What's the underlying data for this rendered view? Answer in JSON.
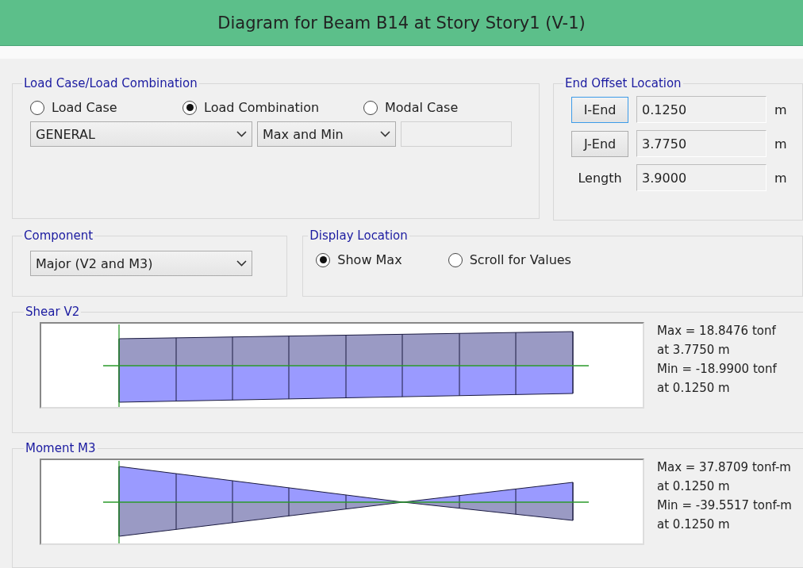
{
  "window": {
    "title": "Diagram for Beam B14 at Story Story1 (V-1)"
  },
  "load_case_group": {
    "title": "Load Case/Load Combination",
    "options": [
      {
        "label": "Load Case",
        "selected": false
      },
      {
        "label": "Load Combination",
        "selected": true
      },
      {
        "label": "Modal Case",
        "selected": false
      }
    ],
    "combination_select": "GENERAL",
    "type_select": "Max and Min"
  },
  "end_offset": {
    "title": "End Offset Location",
    "rows": [
      {
        "kind": "button",
        "label": "I-End",
        "focused": true,
        "value": "0.1250",
        "unit": "m"
      },
      {
        "kind": "button",
        "label": "J-End",
        "focused": false,
        "value": "3.7750",
        "unit": "m"
      },
      {
        "kind": "label",
        "label": "Length",
        "value": "3.9000",
        "unit": "m"
      }
    ]
  },
  "component": {
    "title": "Component",
    "select": "Major (V2 and M3)"
  },
  "display_location": {
    "title": "Display Location",
    "options": [
      {
        "label": "Show Max",
        "selected": true
      },
      {
        "label": "Scroll for Values",
        "selected": false
      }
    ]
  },
  "diagrams": [
    {
      "kind": "shear",
      "title": "Shear V2",
      "results": [
        "Max = 18.8476 tonf",
        "at 3.7750 m",
        "Min = -18.9900 tonf",
        "at 0.1250 m"
      ]
    },
    {
      "kind": "moment",
      "title": "Moment M3",
      "results": [
        "Max = 37.8709 tonf-m",
        "at 0.1250 m",
        "Min = -39.5517 tonf-m",
        "at 0.1250 m"
      ]
    }
  ]
}
